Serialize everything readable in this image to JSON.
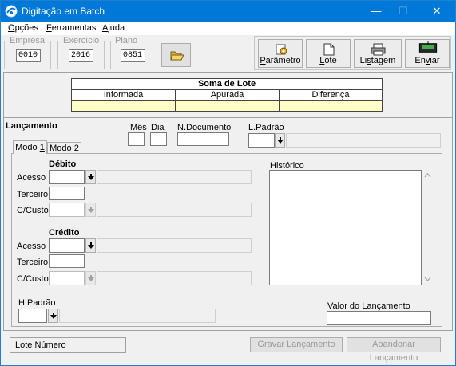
{
  "window": {
    "title": "Digitação em Batch",
    "minimize_glyph": "—",
    "maximize_glyph": "☐",
    "close_glyph": "✕"
  },
  "menu": {
    "opcoes": {
      "underline": "O",
      "rest": "pções"
    },
    "ferramentas": {
      "underline": "F",
      "rest": "erramentas"
    },
    "ajuda": {
      "underline": "A",
      "rest": "juda"
    }
  },
  "header": {
    "empresa": {
      "label": "Empresa",
      "value": "0010"
    },
    "exercicio": {
      "label": "Exercício",
      "value": "2016"
    },
    "plano": {
      "label": "Plano",
      "value": "0851"
    }
  },
  "toolbar": {
    "parametro": {
      "underline": "P",
      "rest": "arâmetro"
    },
    "lote": {
      "underline": "L",
      "rest": "ote"
    },
    "listagem": {
      "pre": "Li",
      "underline": "s",
      "rest": "tagem"
    },
    "enviar": {
      "pre": "En",
      "underline": "v",
      "rest": "iar"
    }
  },
  "soma": {
    "title": "Soma de Lote",
    "columns": [
      "Informada",
      "Apurada",
      "Diferença"
    ]
  },
  "lancamento": {
    "title": "Lançamento",
    "mes_label": "Mês",
    "dia_label": "Dia",
    "ndoc_label": "N.Documento",
    "lpadrao_label": "L.Padrão",
    "tabs": [
      {
        "pre": "Modo ",
        "underline": "1"
      },
      {
        "pre": "Modo ",
        "underline": "2"
      }
    ],
    "debito_title": "Débito",
    "credito_title": "Crédito",
    "acesso_label": "Acesso",
    "terceiro_label": "Terceiro",
    "ccusto_label": "C/Custo",
    "historico_label": "Histórico",
    "hpadrao_label": "H.Padrão",
    "valor_label": "Valor do Lançamento"
  },
  "footer": {
    "lote_numero": "Lote Número",
    "gravar": "Gravar Lançamento",
    "abandonar": "Abandonar Lançamento"
  }
}
